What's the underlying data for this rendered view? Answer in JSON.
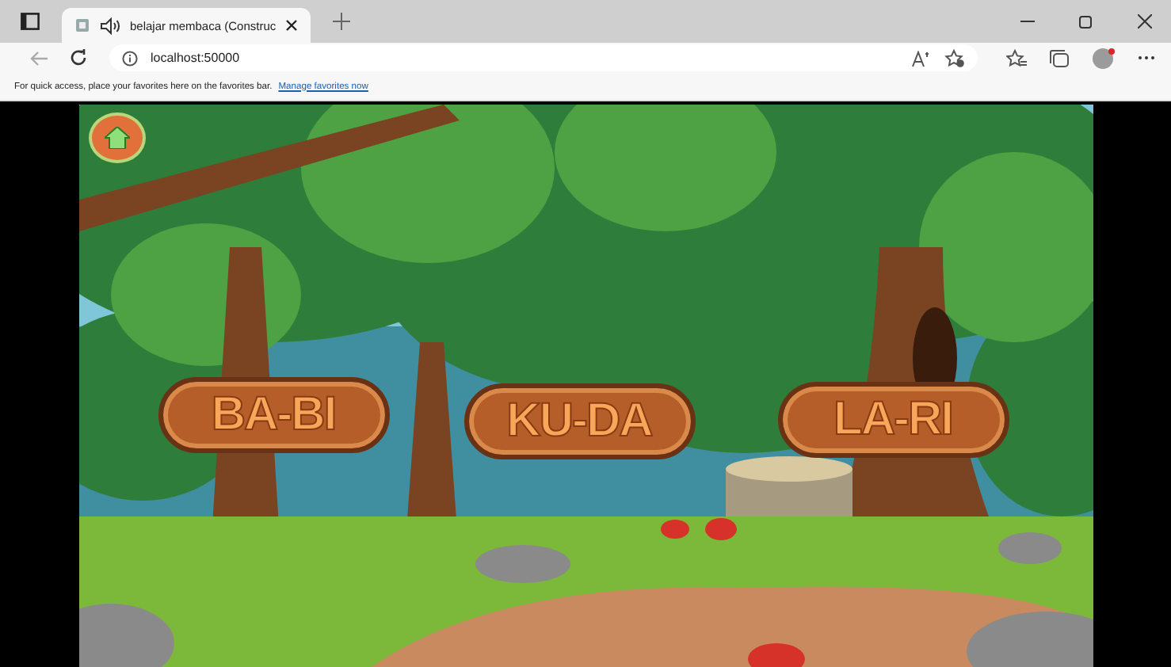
{
  "browser": {
    "tab": {
      "title": "belajar membaca (Construc"
    },
    "address": "localhost:50000",
    "favorites_bar": {
      "message": "For quick access, place your favorites here on the favorites bar.",
      "link": "Manage favorites now"
    }
  },
  "game": {
    "words": [
      {
        "label": "BA-BI"
      },
      {
        "label": "KU-DA"
      },
      {
        "label": "LA-RI"
      }
    ]
  }
}
